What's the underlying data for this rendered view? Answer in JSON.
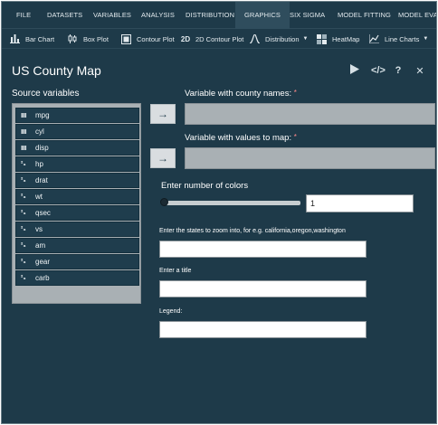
{
  "menu": {
    "items": [
      "FILE",
      "DATASETS",
      "VARIABLES",
      "ANALYSIS",
      "DISTRIBUTION",
      "GRAPHICS",
      "SIX SIGMA",
      "MODEL FITTING",
      "MODEL EVALU"
    ],
    "active": "GRAPHICS"
  },
  "toolbar": {
    "bar_chart": "Bar Chart",
    "box_plot": "Box Plot",
    "contour_plot": "Contour Plot",
    "contour_2d": "2D Contour Plot",
    "distribution": "Distribution",
    "heatmap": "HeatMap",
    "line_charts": "Line Charts"
  },
  "dialog": {
    "title": "US County Map"
  },
  "source": {
    "label": "Source variables",
    "variables": [
      {
        "name": "mpg",
        "type": "scale"
      },
      {
        "name": "cyl",
        "type": "scale"
      },
      {
        "name": "disp",
        "type": "scale"
      },
      {
        "name": "hp",
        "type": "numeric"
      },
      {
        "name": "drat",
        "type": "numeric"
      },
      {
        "name": "wt",
        "type": "numeric"
      },
      {
        "name": "qsec",
        "type": "numeric"
      },
      {
        "name": "vs",
        "type": "numeric"
      },
      {
        "name": "am",
        "type": "numeric"
      },
      {
        "name": "gear",
        "type": "numeric"
      },
      {
        "name": "carb",
        "type": "numeric"
      }
    ]
  },
  "fields": {
    "county_names_label": "Variable with county names:",
    "values_label": "Variable with values to map:",
    "required_mark": "*",
    "num_colors_label": "Enter number of colors",
    "num_colors_value": "1",
    "num_colors_slider_fraction": 0.0,
    "states_label": "Enter the states to zoom into, for e.g. california,oregon,washington",
    "title_label": "Enter a title",
    "legend_label": "Legend:"
  }
}
